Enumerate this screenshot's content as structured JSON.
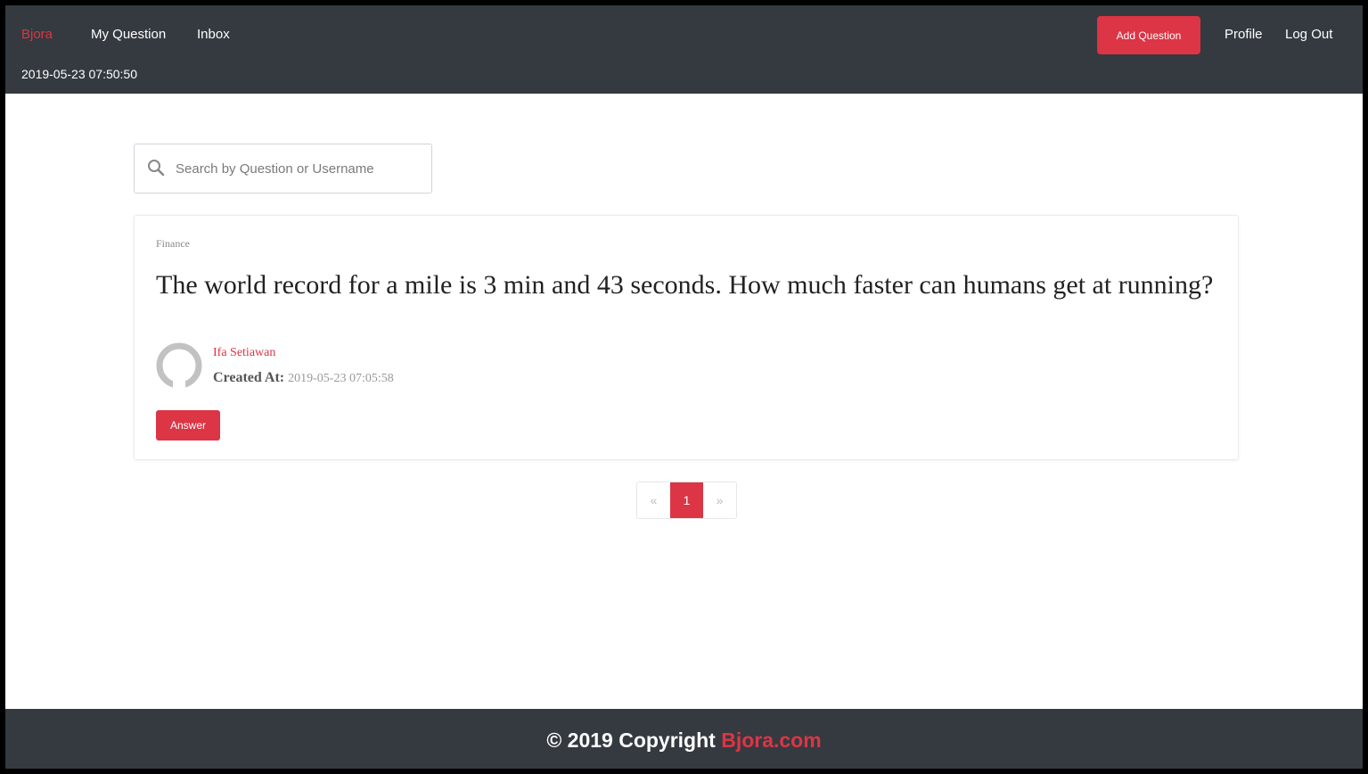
{
  "colors": {
    "accent": "#dc3545",
    "navbar": "#343a40",
    "background": "#ffffff"
  },
  "navbar": {
    "brand": "Bjora",
    "links": [
      "My Question",
      "Inbox"
    ],
    "clock": "2019-05-23 07:50:50",
    "add_question": "Add Question",
    "profile": "Profile",
    "logout": "Log Out"
  },
  "search": {
    "placeholder": "Search by Question or Username",
    "icon": "search-icon"
  },
  "question_card": {
    "category": "Finance",
    "question": "The world record for a mile is 3 min and 43 seconds. How much faster can humans get at running?",
    "author": "Ifa Setiawan",
    "created_label": "Created At:",
    "created_value": "2019-05-23 07:05:58",
    "answer_button": "Answer"
  },
  "pagination": {
    "prev": "«",
    "current": "1",
    "next": "»"
  },
  "footer": {
    "copyright": "© 2019 Copyright",
    "brand": "Bjora.com"
  }
}
